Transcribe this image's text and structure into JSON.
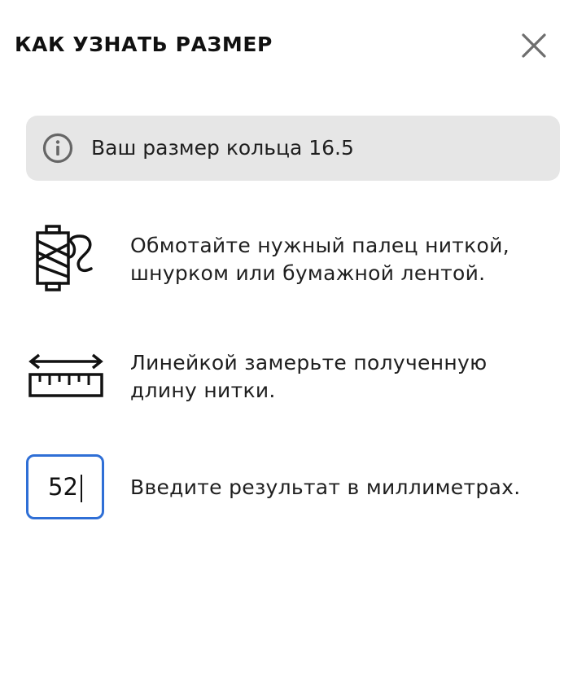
{
  "header": {
    "title": "КАК УЗНАТЬ РАЗМЕР",
    "close_icon": "close-icon"
  },
  "info": {
    "icon": "info-icon",
    "text": "Ваш размер кольца 16.5"
  },
  "steps": [
    {
      "icon": "thread-spool-icon",
      "lines": [
        "Обмотайте нужный палец ниткой,",
        "шнурком или бумажной лентой."
      ]
    },
    {
      "icon": "ruler-icon",
      "lines": [
        "Линейкой замерьте полученную",
        "длину нитки."
      ]
    },
    {
      "icon": "size-input",
      "lines": [
        "Введите результат в миллиметрах."
      ]
    }
  ],
  "size_input": {
    "value": "52"
  },
  "colors": {
    "accent": "#2f6fd6",
    "info_bg": "#e6e6e6",
    "text": "#1f1f1f",
    "icon": "#6e6e6e"
  }
}
